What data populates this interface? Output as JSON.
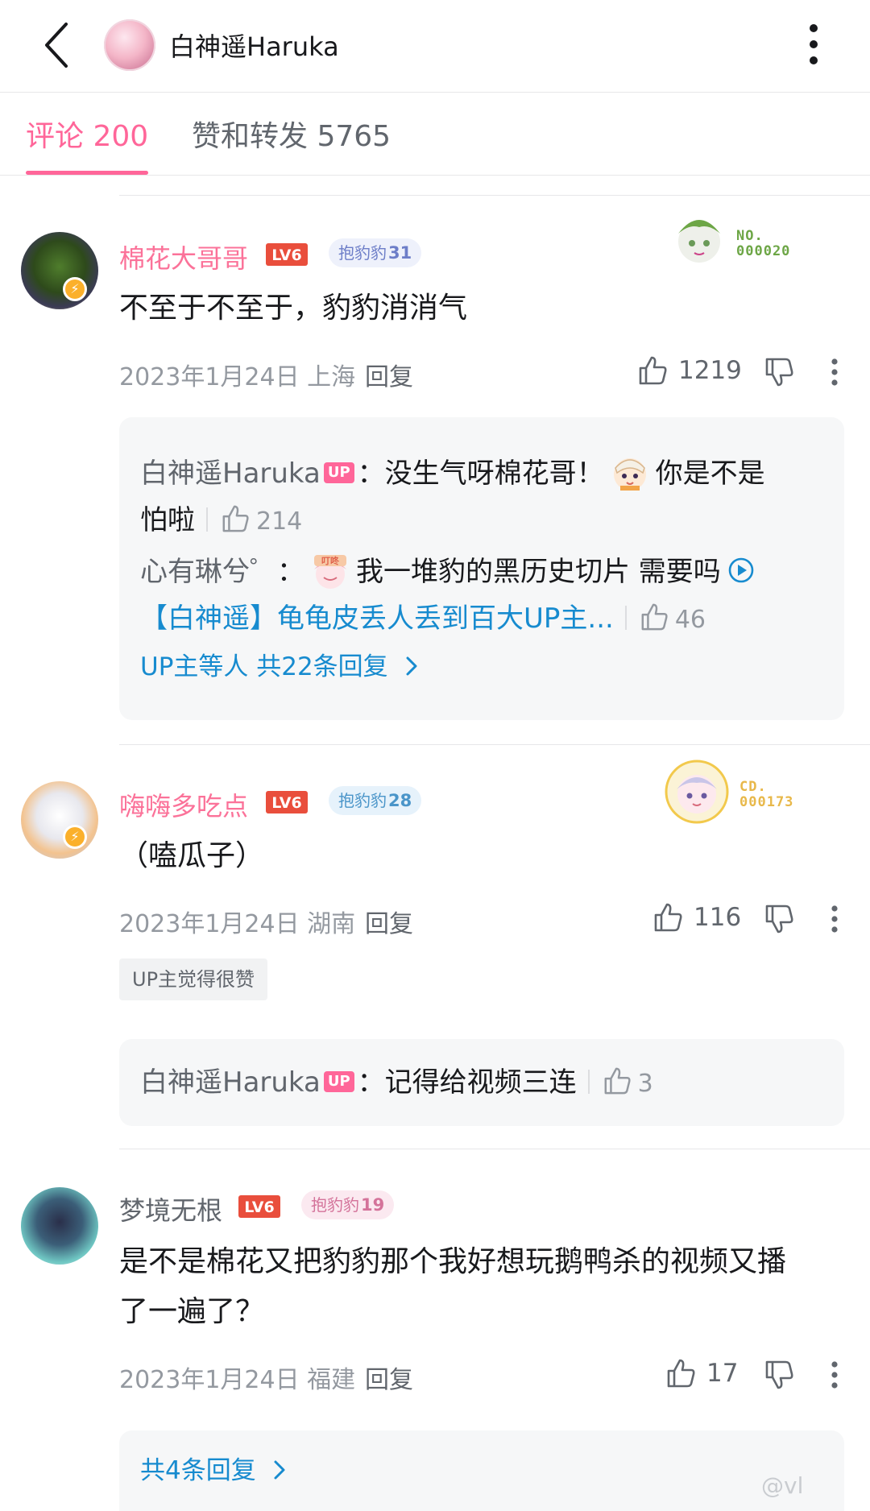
{
  "header": {
    "title": "白神遥Haruka"
  },
  "tabs": [
    {
      "label": "评论 200",
      "active": true
    },
    {
      "label": "赞和转发 5765",
      "active": false
    }
  ],
  "colors": {
    "accent": "#ff6699",
    "link": "#178bcf",
    "muted": "#9499a0",
    "lv6": "#e94e3c"
  },
  "comments": [
    {
      "username": "棉花大哥哥",
      "level": "LV6",
      "fan_medal": {
        "name": "抱豹豹",
        "level": "31"
      },
      "garb_no": "NO.\n000020",
      "content": "不至于不至于，豹豹消消气",
      "date_location": "2023年1月24日 上海",
      "reply_label": "回复",
      "likes": "1219",
      "replies": {
        "items": [
          {
            "name": "白神遥Haruka",
            "up": "UP",
            "text_a": "：没生气呀棉花哥！",
            "sticker": "paimon-sticker",
            "text_b": "你是不是",
            "line2": "怕啦",
            "likes": "214"
          },
          {
            "name": "心有琳兮゜",
            "text_a": "：",
            "sticker": "ding-sticker",
            "text_b": "我一堆豹的黑历史切片 需要吗",
            "link": "【白神遥】龟龟皮丢人丢到百大UP主...",
            "likes": "46"
          }
        ],
        "more": "UP主等人 共22条回复"
      }
    },
    {
      "username": "嗨嗨多吃点",
      "level": "LV6",
      "fan_medal": {
        "name": "抱豹豹",
        "level": "28"
      },
      "garb_no": "CD.\n000173",
      "content": "（嗑瓜子）",
      "date_location": "2023年1月24日 湖南",
      "reply_label": "回复",
      "likes": "116",
      "tag": "UP主觉得很赞",
      "replies": {
        "items": [
          {
            "name": "白神遥Haruka",
            "up": "UP",
            "text_a": "：记得给视频三连",
            "likes": "3"
          }
        ]
      }
    },
    {
      "username": "梦境无根",
      "level": "LV6",
      "fan_medal": {
        "name": "抱豹豹",
        "level": "19"
      },
      "content_line1": "是不是棉花又把豹豹那个我好想玩鹅鸭杀的视频又播",
      "content_line2": "了一遍了？",
      "date_location": "2023年1月24日 福建",
      "reply_label": "回复",
      "likes": "17",
      "replies": {
        "more": "共4条回复"
      }
    }
  ],
  "watermark": "@vl"
}
